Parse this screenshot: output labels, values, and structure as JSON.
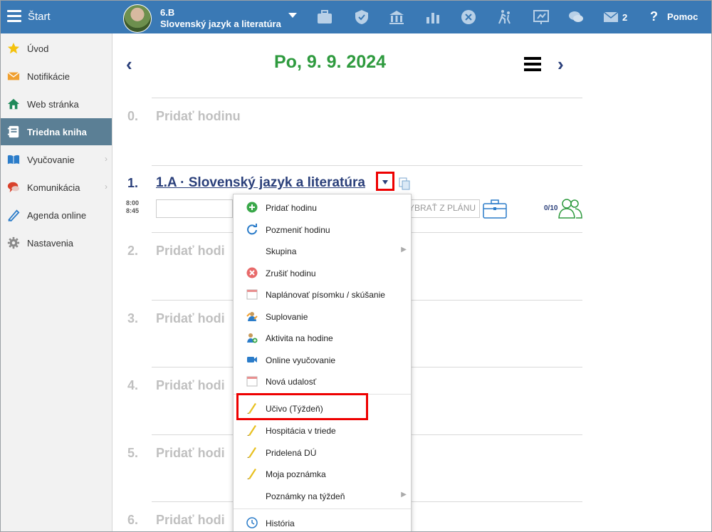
{
  "topbar": {
    "app_title": "Štart",
    "class_name": "6.B",
    "subject_name": "Slovenský jazyk a literatúra",
    "mail_count": "2",
    "help_label": "Pomoc",
    "help_glyph": "?",
    "icons": [
      "briefcase-icon",
      "shield-icon",
      "institution-icon",
      "bar-chart-icon",
      "no-entry-icon",
      "walking-icon",
      "whiteboard-icon",
      "chat-icon",
      "mail-icon"
    ]
  },
  "sidebar": {
    "items": [
      {
        "label": "Úvod",
        "icon": "star-icon"
      },
      {
        "label": "Notifikácie",
        "icon": "envelope-icon"
      },
      {
        "label": "Web stránka",
        "icon": "house-icon"
      },
      {
        "label": "Triedna kniha",
        "icon": "notebook-icon",
        "active": true
      },
      {
        "label": "Vyučovanie",
        "icon": "book-icon",
        "chevron": true
      },
      {
        "label": "Komunikácia",
        "icon": "speech-icon",
        "chevron": true
      },
      {
        "label": "Agenda online",
        "icon": "pen-icon"
      },
      {
        "label": "Nastavenia",
        "icon": "gear-icon"
      }
    ]
  },
  "main": {
    "date": "Po, 9. 9. 2024",
    "prev_glyph": "‹",
    "next_glyph": "›",
    "lessons": [
      {
        "num": "0.",
        "label": "Pridať hodinu"
      },
      {
        "num": "1.",
        "label": "1.A · Slovenský jazyk a literatúra",
        "time_start": "8:00",
        "time_end": "8:45",
        "plan_button": "YBRAŤ Z PLÁNU",
        "attendance": "0/10"
      },
      {
        "num": "2.",
        "label": "Pridať hodi"
      },
      {
        "num": "3.",
        "label": "Pridať hodi"
      },
      {
        "num": "4.",
        "label": "Pridať hodi"
      },
      {
        "num": "5.",
        "label": "Pridať hodi"
      },
      {
        "num": "6.",
        "label": "Pridať hodi"
      }
    ]
  },
  "context_menu": {
    "items": [
      {
        "label": "Pridať hodinu",
        "icon": "plus-circle-icon"
      },
      {
        "label": "Pozmeniť hodinu",
        "icon": "refresh-icon"
      },
      {
        "label": "Skupina",
        "submenu": "▶"
      },
      {
        "label": "Zrušiť hodinu",
        "icon": "cancel-icon"
      },
      {
        "label": "Naplánovať písomku / skúšanie",
        "icon": "calendar-icon"
      },
      {
        "label": "Suplovanie",
        "icon": "substitute-icon"
      },
      {
        "label": "Aktivita na hodine",
        "icon": "activity-icon"
      },
      {
        "label": "Online vyučovanie",
        "icon": "video-camera-icon"
      },
      {
        "label": "Nová udalosť",
        "icon": "calendar-icon"
      },
      {
        "label": "Učivo (Týždeň)",
        "icon": "pencil-icon"
      },
      {
        "label": "Hospitácia v triede",
        "icon": "pencil-icon"
      },
      {
        "label": "Pridelená DÚ",
        "icon": "pencil-icon"
      },
      {
        "label": "Moja poznámka",
        "icon": "pencil-icon"
      },
      {
        "label": "Poznámky na týždeň",
        "submenu": "▶"
      },
      {
        "label": "História",
        "icon": "clock-icon"
      }
    ]
  },
  "colors": {
    "topbar": "#3a79b5",
    "sidebar_active": "#5b7f95",
    "date": "#2e9a3e",
    "lesson_link": "#2a3f7a",
    "highlight": "#e00000"
  }
}
